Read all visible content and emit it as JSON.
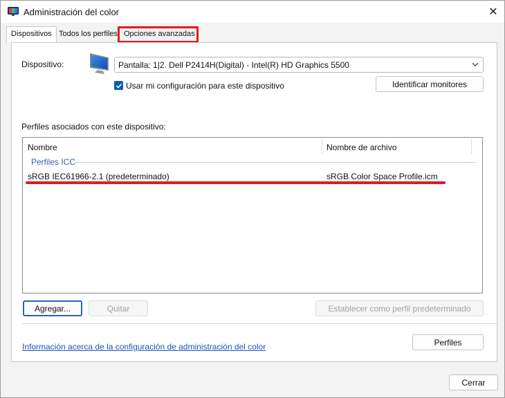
{
  "window": {
    "title": "Administración del color",
    "close_glyph": "✕"
  },
  "tabs": [
    {
      "label": "Dispositivos"
    },
    {
      "label": "Todos los perfiles"
    },
    {
      "label": "Opciones avanzadas"
    }
  ],
  "device": {
    "label": "Dispositivo:",
    "selected": "Pantalla: 1|2. Dell P2414H(Digital) - Intel(R) HD Graphics 5500",
    "use_settings_label": "Usar mi configuración para este dispositivo",
    "use_settings_checked": true,
    "identify_button": "Identificar monitores"
  },
  "profiles": {
    "section_label": "Perfiles asociados con este dispositivo:",
    "columns": [
      "Nombre",
      "Nombre de archivo"
    ],
    "group_label": "Perfiles ICC",
    "rows": [
      {
        "name": "sRGB IEC61966-2.1 (predeterminado)",
        "file": "sRGB Color Space Profile.icm"
      }
    ]
  },
  "actions": {
    "add": "Agregar...",
    "remove": "Quitar",
    "set_default": "Establecer como perfil predeterminado"
  },
  "footer": {
    "info_link": "Información acerca de la configuración de administración del color",
    "profiles_button": "Perfiles",
    "close_button": "Cerrar"
  },
  "colors": {
    "highlight": "#e11b22",
    "accent": "#0b5cad",
    "link": "#1a55b8"
  },
  "icons": {
    "app": "color-management-icon",
    "device": "monitor-icon",
    "dropdown": "chevron-down-icon",
    "check": "checkmark-icon"
  }
}
